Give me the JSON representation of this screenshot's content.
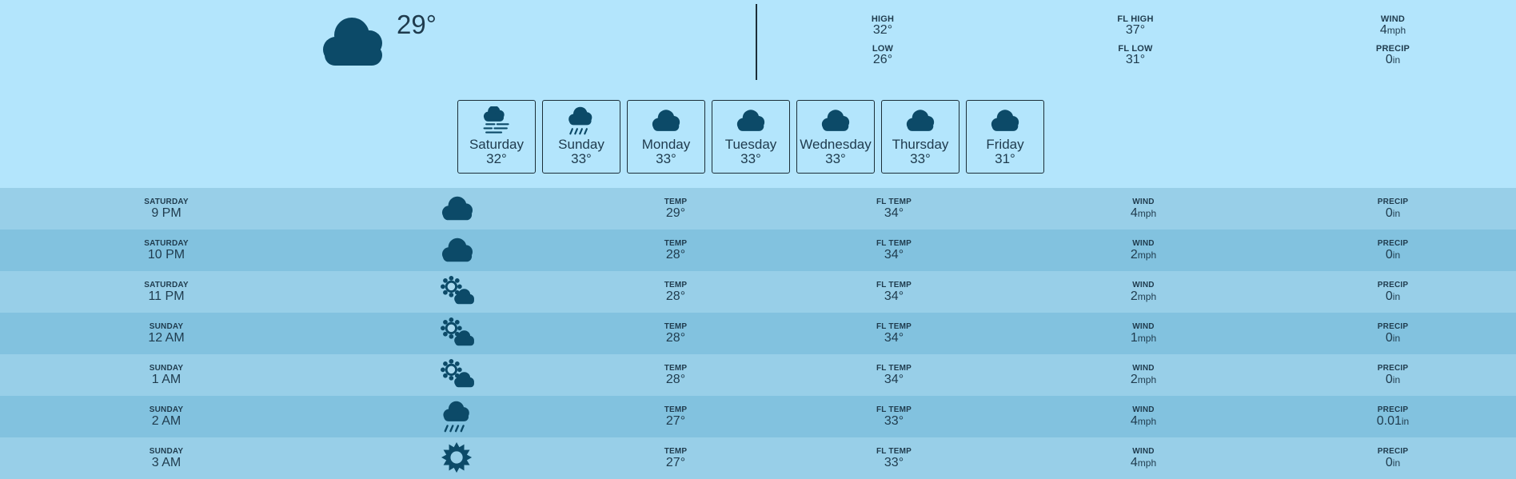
{
  "current": {
    "icon": "cloud-icon",
    "temp": "29°",
    "stats": {
      "high": {
        "label": "HIGH",
        "value": "32°"
      },
      "low": {
        "label": "LOW",
        "value": "26°"
      },
      "fl_high": {
        "label": "FL HIGH",
        "value": "37°"
      },
      "fl_low": {
        "label": "FL LOW",
        "value": "31°"
      },
      "wind": {
        "label": "WIND",
        "value": "4",
        "unit": "mph"
      },
      "precip": {
        "label": "PRECIP",
        "value": "0",
        "unit": "in"
      }
    }
  },
  "days": [
    {
      "name": "Saturday",
      "temp": "32°",
      "icon": "fog-cloud-icon"
    },
    {
      "name": "Sunday",
      "temp": "33°",
      "icon": "rain-cloud-icon"
    },
    {
      "name": "Monday",
      "temp": "33°",
      "icon": "cloud-icon"
    },
    {
      "name": "Tuesday",
      "temp": "33°",
      "icon": "cloud-icon"
    },
    {
      "name": "Wednesday",
      "temp": "33°",
      "icon": "cloud-icon"
    },
    {
      "name": "Thursday",
      "temp": "33°",
      "icon": "cloud-icon"
    },
    {
      "name": "Friday",
      "temp": "31°",
      "icon": "cloud-icon"
    }
  ],
  "labels": {
    "temp": "TEMP",
    "fl_temp": "FL TEMP",
    "wind": "WIND",
    "precip": "PRECIP",
    "wind_unit": "mph",
    "precip_unit": "in"
  },
  "hours": [
    {
      "day": "SATURDAY",
      "time": "9 PM",
      "icon": "cloud-icon",
      "temp": "29°",
      "fl_temp": "34°",
      "wind": "4",
      "precip": "0"
    },
    {
      "day": "SATURDAY",
      "time": "10 PM",
      "icon": "cloud-icon",
      "temp": "28°",
      "fl_temp": "34°",
      "wind": "2",
      "precip": "0"
    },
    {
      "day": "SATURDAY",
      "time": "11 PM",
      "icon": "partly-cloudy-icon",
      "temp": "28°",
      "fl_temp": "34°",
      "wind": "2",
      "precip": "0"
    },
    {
      "day": "SUNDAY",
      "time": "12 AM",
      "icon": "partly-cloudy-icon",
      "temp": "28°",
      "fl_temp": "34°",
      "wind": "1",
      "precip": "0"
    },
    {
      "day": "SUNDAY",
      "time": "1 AM",
      "icon": "partly-cloudy-icon",
      "temp": "28°",
      "fl_temp": "34°",
      "wind": "2",
      "precip": "0"
    },
    {
      "day": "SUNDAY",
      "time": "2 AM",
      "icon": "rain-cloud-icon",
      "temp": "27°",
      "fl_temp": "33°",
      "wind": "4",
      "precip": "0.01"
    },
    {
      "day": "SUNDAY",
      "time": "3 AM",
      "icon": "sun-icon",
      "temp": "27°",
      "fl_temp": "33°",
      "wind": "4",
      "precip": "0"
    }
  ],
  "colors": {
    "icon": "#0c4a68",
    "bg": "#b3e5fc",
    "row_odd": "#98cfe8",
    "row_even": "#82c2df",
    "text": "#1f3b4d"
  }
}
